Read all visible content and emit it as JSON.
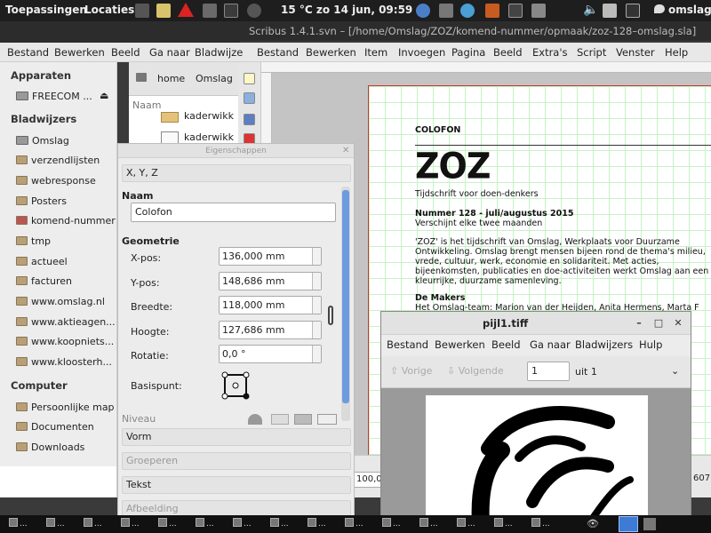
{
  "topbar": {
    "menu_apps": "Toepassingen",
    "menu_places": "Locaties",
    "clock": "15 °C   zo 14 jun, 09:59",
    "user": "omslag"
  },
  "filemanager": {
    "menubar": [
      "Bestand",
      "Bewerken",
      "Beeld",
      "Ga naar",
      "Bladwijze"
    ],
    "path": [
      "home",
      "Omslag"
    ],
    "list_header": "Naam",
    "list_items": [
      "kaderwikk",
      "kaderwikk"
    ],
    "sidebar": {
      "section_devices": "Apparaten",
      "devices": [
        "FREECOM ..."
      ],
      "section_bookmarks": "Bladwijzers",
      "bookmarks": [
        "Omslag",
        "verzendlijsten",
        "webresponse",
        "Posters",
        "komend-nummer",
        "tmp",
        "actueel",
        "facturen",
        "www.omslag.nl",
        "www.aktieagen...",
        "www.koopniets...",
        "www.kloosterh..."
      ],
      "section_computer": "Computer",
      "computer": [
        "Persoonlijke map",
        "Documenten",
        "Downloads"
      ]
    }
  },
  "scribus": {
    "title": "Scribus 1.4.1.svn – [/home/Omslag/ZOZ/komend-nummer/opmaak/zoz-128–omslag.sla]",
    "menubar": [
      "Bestand",
      "Bewerken",
      "Item",
      "Invoegen",
      "Pagina",
      "Beeld",
      "Extra's",
      "Script",
      "Venster",
      "Help"
    ],
    "status_zoom": "100,00",
    "status_coord": "607",
    "page": {
      "colofon": "COLOFON",
      "logo": "ZOZ",
      "tagline": "Tijdschrift voor doen-denkers",
      "issue": "Nummer 128 - juli/augustus 2015",
      "frequency": "Verschijnt elke twee maanden",
      "body": [
        "'ZOZ' is het tijdschrift van Omslag, Werkplaats voor Duurzame",
        "Ontwikkeling. Omslag brengt mensen bijeen rond de thema's milieu,",
        "vrede, cultuur, werk, economie en solidariteit. Met acties,",
        "bijeenkomsten, publicaties en doe-activiteiten werkt Omslag aan een",
        "kleurrijke, duurzame samenleving."
      ],
      "makers_head": "De Makers",
      "makers_text": "Het Omslag-team: Marion van der Heijden, Anita Hermens, Marta F"
    }
  },
  "properties": {
    "window_title": "Eigenschappen",
    "tab_xyz": "X, Y, Z",
    "name_label": "Naam",
    "name_value": "Colofon",
    "geometry_label": "Geometrie",
    "fields": [
      {
        "label": "X-pos:",
        "value": "136,000 mm"
      },
      {
        "label": "Y-pos:",
        "value": "148,686 mm"
      },
      {
        "label": "Breedte:",
        "value": "118,000 mm"
      },
      {
        "label": "Hoogte:",
        "value": "127,686 mm"
      },
      {
        "label": "Rotatie:",
        "value": "0,0 °"
      }
    ],
    "basepoint_label": "Basispunt:",
    "level_label": "Niveau",
    "tabs": [
      "Vorm",
      "Groeperen",
      "Tekst",
      "Afbeelding"
    ]
  },
  "viewer": {
    "title": "pijl1.tiff",
    "menubar": [
      "Bestand",
      "Bewerken",
      "Beeld",
      "Ga naar",
      "Bladwijzers",
      "Hulp"
    ],
    "prev_label": "Vorige",
    "next_label": "Volgende",
    "page_value": "1",
    "page_of": "uit 1",
    "btn_minimize": "–",
    "btn_maximize": "□",
    "btn_close": "✕"
  },
  "taskbar": {
    "tasks": [
      "...",
      "...",
      "...",
      "...",
      "...",
      "...",
      "...",
      "...",
      "...",
      "...",
      "...",
      "...",
      "...",
      "...",
      "..."
    ]
  },
  "colors": {
    "panel": "#1e1e1e",
    "accent": "#6d9ae0",
    "page_border": "#cc3333",
    "grid": "#bff2bf"
  }
}
